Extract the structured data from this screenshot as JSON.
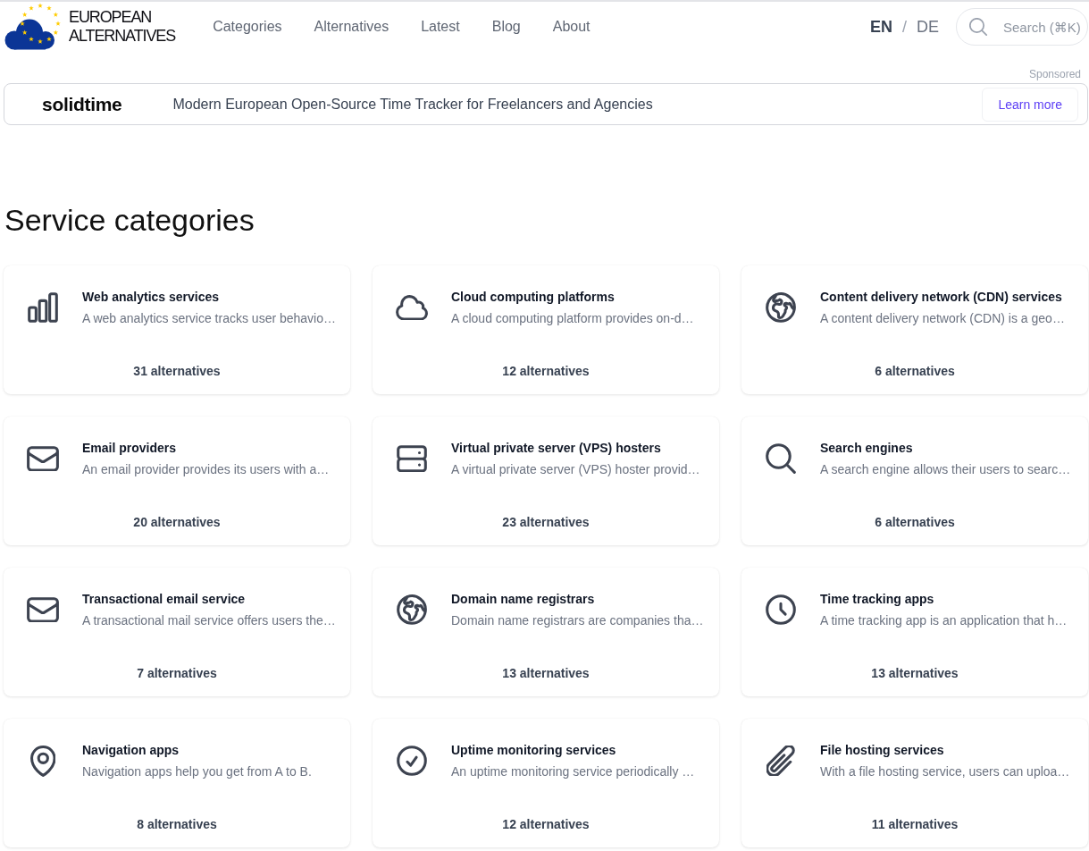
{
  "brand": {
    "name": "EUROPEAN ALTERNATIVES"
  },
  "nav": [
    {
      "label": "Categories"
    },
    {
      "label": "Alternatives"
    },
    {
      "label": "Latest"
    },
    {
      "label": "Blog"
    },
    {
      "label": "About"
    }
  ],
  "languages": [
    {
      "label": "EN",
      "selected": true
    },
    {
      "label": "DE",
      "selected": false
    }
  ],
  "language_separator": "/",
  "search": {
    "placeholder": "Search (⌘K)"
  },
  "sponsor": {
    "label": "Sponsored",
    "name": "solidtime",
    "tagline": "Modern European Open-Source Time Tracker for Freelancers and Agencies",
    "button": "Learn more"
  },
  "heading": "Service categories",
  "categories": [
    {
      "kind": "chart",
      "title": "Web analytics services",
      "description": "A web analytics service tracks user behavio…",
      "count": "31 alternatives"
    },
    {
      "kind": "cloud",
      "title": "Cloud computing platforms",
      "description": "A cloud computing platform provides on-d…",
      "count": "12 alternatives"
    },
    {
      "kind": "globe",
      "title": "Content delivery network (CDN) services",
      "description": "A content delivery network (CDN) is a geo…",
      "count": "6 alternatives"
    },
    {
      "kind": "envelope",
      "title": "Email providers",
      "description": "An email provider provides its users with a…",
      "count": "20 alternatives"
    },
    {
      "kind": "server",
      "title": "Virtual private server (VPS) hosters",
      "description": "A virtual private server (VPS) hoster provid…",
      "count": "23 alternatives"
    },
    {
      "kind": "magnifier",
      "title": "Search engines",
      "description": "A search engine allows their users to searc…",
      "count": "6 alternatives"
    },
    {
      "kind": "envelope",
      "title": "Transactional email service",
      "description": "A transactional mail service offers users the…",
      "count": "7 alternatives"
    },
    {
      "kind": "globe",
      "title": "Domain name registrars",
      "description": "Domain name registrars are companies tha…",
      "count": "13 alternatives"
    },
    {
      "kind": "clock",
      "title": "Time tracking apps",
      "description": "A time tracking app is an application that h…",
      "count": "13 alternatives"
    },
    {
      "kind": "pin",
      "title": "Navigation apps",
      "description": "Navigation apps help you get from A to B.",
      "count": "8 alternatives"
    },
    {
      "kind": "check",
      "title": "Uptime monitoring services",
      "description": "An uptime monitoring service periodically …",
      "count": "12 alternatives"
    },
    {
      "kind": "paperclip",
      "title": "File hosting services",
      "description": "With a file hosting service, users can uploa…",
      "count": "11 alternatives"
    }
  ]
}
